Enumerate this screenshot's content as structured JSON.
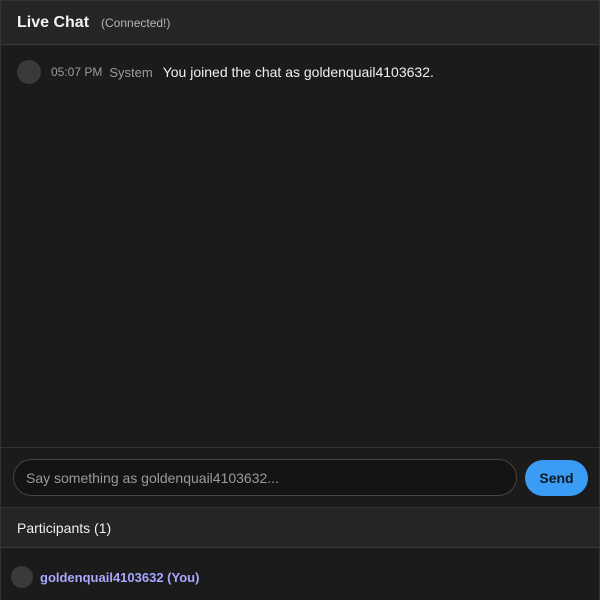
{
  "header": {
    "title": "Live Chat",
    "status": "(Connected!)"
  },
  "messages": [
    {
      "time": "05:07 PM",
      "user": "System",
      "text": "You joined the chat as goldenquail4103632."
    }
  ],
  "composer": {
    "placeholder": "Say something as goldenquail4103632...",
    "send_label": "Send"
  },
  "participants": {
    "header": "Participants (1)",
    "items": [
      {
        "name": "goldenquail4103632 (You)"
      }
    ]
  },
  "colors": {
    "accent": "#3b9cf5",
    "participant_name": "#a9a8ff",
    "background": "#1b1b1b",
    "panel": "#252525"
  }
}
